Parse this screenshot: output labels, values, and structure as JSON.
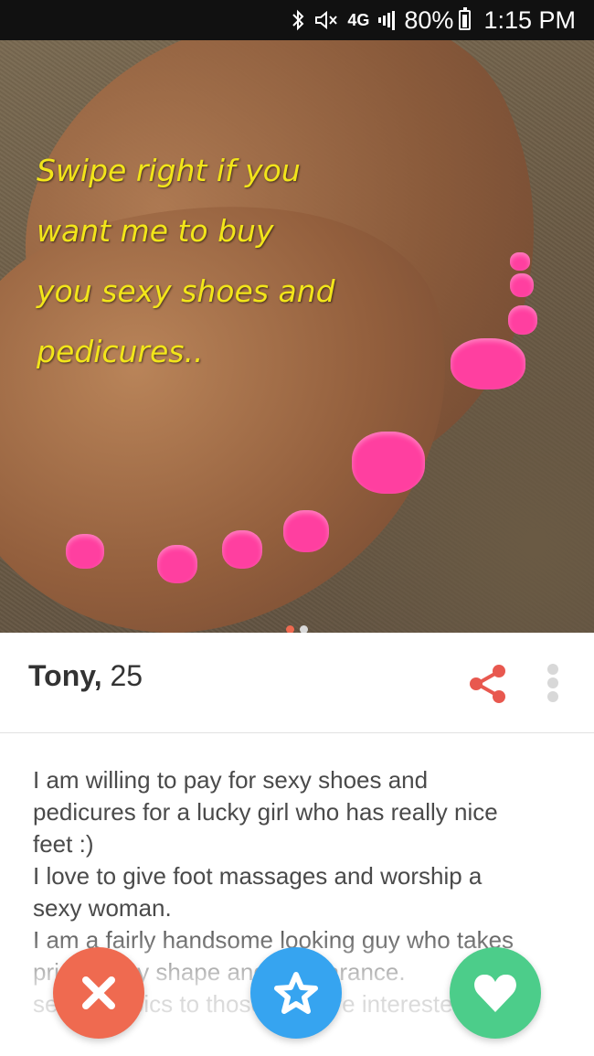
{
  "status_bar": {
    "network": "4G",
    "battery": "80%",
    "time": "1:15 PM"
  },
  "photo": {
    "caption_lines": [
      "Swipe right if you",
      "want me to buy",
      "you sexy shoes and",
      "pedicures.."
    ],
    "page_count": 2,
    "active_page": 1,
    "caption_color": "#f2e51a",
    "nail_color": "#ff3fa0"
  },
  "profile": {
    "name": "Tony,",
    "age": "25",
    "bio": "I am willing to pay for sexy shoes and\npedicures for a lucky girl who has really nice\nfeet :)\nI love to give foot massages and worship a\nsexy woman.\nI am a fairly handsome looking guy who takes\npride in my shape and appearance.\nsend me pics to those who are interested"
  },
  "actions": {
    "nope_icon": "close-icon",
    "super_like_icon": "star-icon",
    "like_icon": "heart-icon",
    "colors": {
      "nope": "#ef6a50",
      "super_like": "#36a4f0",
      "like": "#4ccd8a",
      "share": "#e8584f"
    }
  }
}
